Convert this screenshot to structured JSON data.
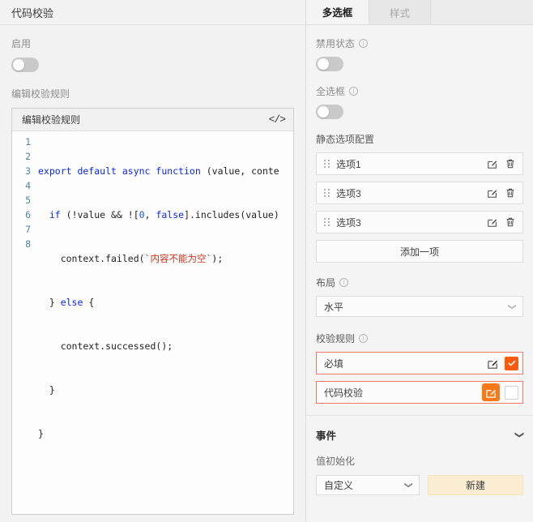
{
  "left": {
    "header_title": "代码校验",
    "enable_label": "启用",
    "enable_toggle_state": "off",
    "edit_rule_label": "编辑校验规则",
    "editor": {
      "title": "编辑校验规则",
      "code_icon": "</>",
      "line_numbers": [
        "1",
        "2",
        "3",
        "4",
        "5",
        "6",
        "7",
        "8"
      ],
      "lines": [
        "export default async function (value, conte",
        "  if (!value && ![0, false].includes(value)",
        "    context.failed(`内容不能为空`);",
        "  } else {",
        "    context.successed();",
        "  }",
        "}",
        ""
      ]
    }
  },
  "right": {
    "tabs": [
      {
        "label": "多选框",
        "active": true
      },
      {
        "label": "样式",
        "active": false
      }
    ],
    "disabled_state": {
      "label": "禁用状态",
      "toggle_state": "off"
    },
    "select_all": {
      "label": "全选框",
      "toggle_state": "off"
    },
    "static_options": {
      "label": "静态选项配置",
      "items": [
        {
          "name": "选项1"
        },
        {
          "name": "选项3"
        },
        {
          "name": "选项3"
        }
      ],
      "add_label": "添加一项"
    },
    "layout": {
      "label": "布局",
      "value": "水平"
    },
    "validation": {
      "label": "校验规则",
      "rules": [
        {
          "name": "必填",
          "checked": true,
          "edit_active": false
        },
        {
          "name": "代码校验",
          "checked": false,
          "edit_active": true
        }
      ]
    },
    "events": {
      "title": "事件",
      "value_init_label": "值初始化",
      "value_init_value": "自定义",
      "new_button": "新建"
    }
  },
  "colors": {
    "accent_orange": "#fa5b0f",
    "edit_active_orange": "#f97918",
    "rule_border_red": "#f5786b",
    "new_button_bg": "#faedd2",
    "line_number_blue": "#4b87a8",
    "keyword_blue": "#0a26f5",
    "string_red": "#d12f1b"
  }
}
